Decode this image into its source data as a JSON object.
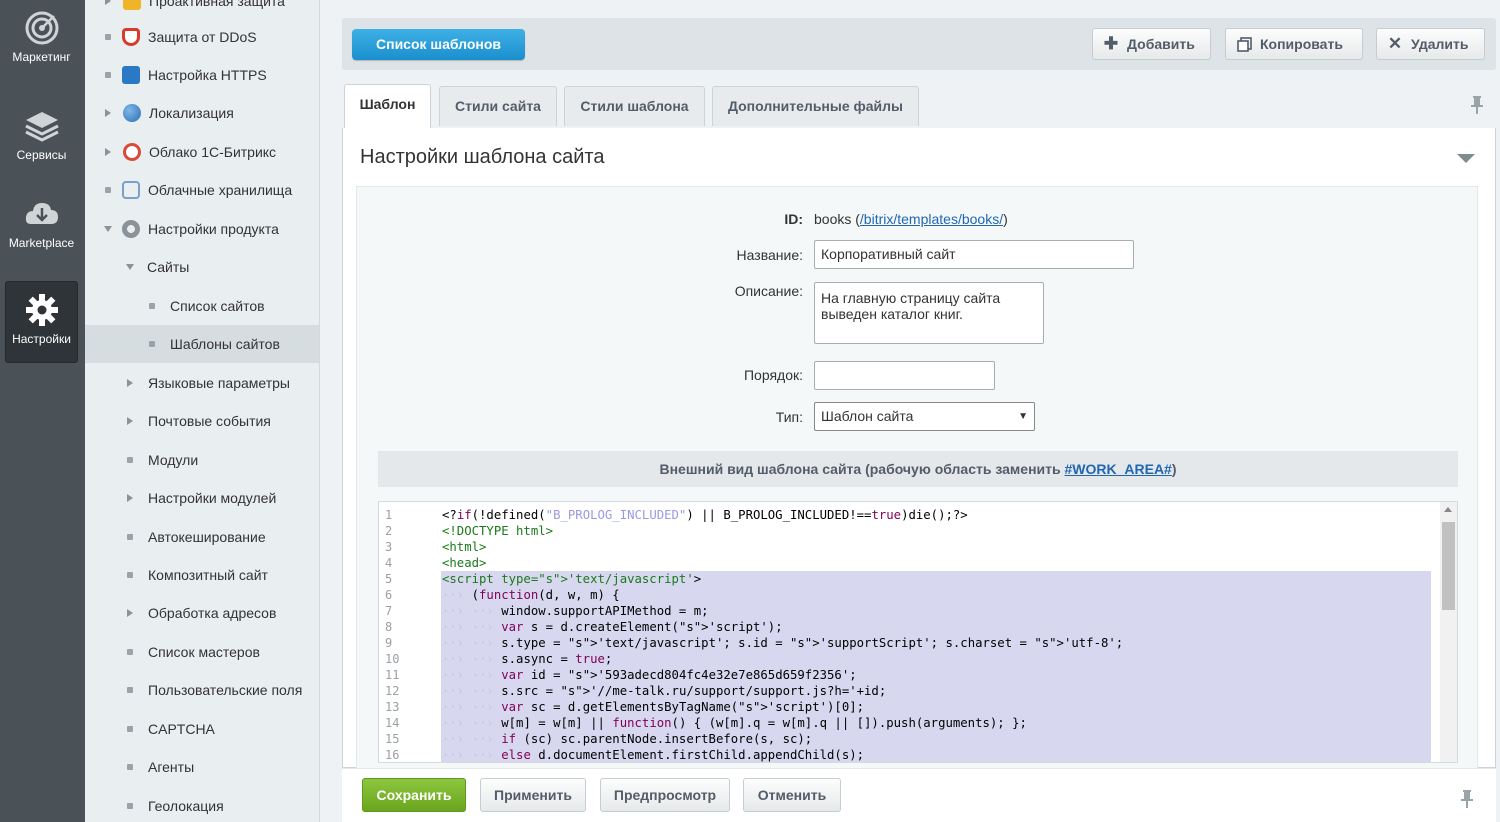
{
  "rail": {
    "items": [
      {
        "label": "Маркетинг",
        "icon": "target-icon"
      },
      {
        "label": "Сервисы",
        "icon": "layers-icon"
      },
      {
        "label": "Marketplace",
        "icon": "cloud-download-icon"
      },
      {
        "label": "Настройки",
        "icon": "gear-icon",
        "active": true
      }
    ]
  },
  "tree": {
    "items": [
      {
        "label": "Проактивная защита"
      },
      {
        "label": "Защита от DDoS"
      },
      {
        "label": "Настройка HTTPS"
      },
      {
        "label": "Локализация"
      },
      {
        "label": "Облако 1С-Битрикс"
      },
      {
        "label": "Облачные хранилища"
      },
      {
        "label": "Настройки продукта"
      },
      {
        "label": "Сайты"
      },
      {
        "label": "Список сайтов"
      },
      {
        "label": "Шаблоны сайтов"
      },
      {
        "label": "Языковые параметры"
      },
      {
        "label": "Почтовые события"
      },
      {
        "label": "Модули"
      },
      {
        "label": "Настройки модулей"
      },
      {
        "label": "Автокеширование"
      },
      {
        "label": "Композитный сайт"
      },
      {
        "label": "Обработка адресов"
      },
      {
        "label": "Список мастеров"
      },
      {
        "label": "Пользовательские поля"
      },
      {
        "label": "CAPTCHA"
      },
      {
        "label": "Агенты"
      },
      {
        "label": "Геолокация"
      }
    ]
  },
  "toolbar": {
    "list_label": "Список шаблонов",
    "add_label": "Добавить",
    "copy_label": "Копировать",
    "delete_label": "Удалить"
  },
  "tabs": [
    {
      "label": "Шаблон",
      "active": true
    },
    {
      "label": "Стили сайта"
    },
    {
      "label": "Стили шаблона"
    },
    {
      "label": "Дополнительные файлы"
    }
  ],
  "section_title": "Настройки шаблона сайта",
  "form": {
    "id_label": "ID:",
    "id_value": "books",
    "id_paren_open": "(",
    "id_link": "/bitrix/templates/books/",
    "id_paren_close": ")",
    "name_label": "Название:",
    "name_value": "Корпоративный сайт",
    "desc_label": "Описание:",
    "desc_value": "На главную страницу сайта выведен каталог книг.",
    "order_label": "Порядок:",
    "order_value": "",
    "type_label": "Тип:",
    "type_value": "Шаблон сайта"
  },
  "appearance": {
    "text": "Внешний вид шаблона сайта (рабочую область заменить ",
    "link": "#WORK_AREA#",
    "close": ")"
  },
  "code_lines": [
    "<?if(!defined(\"B_PROLOG_INCLUDED\") || B_PROLOG_INCLUDED!==true)die();?>",
    "<!DOCTYPE html>",
    "<html>",
    "<head>",
    "<script type='text/javascript'>",
    "    (function(d, w, m) {",
    "        window.supportAPIMethod = m;",
    "        var s = d.createElement('script');",
    "        s.type = 'text/javascript'; s.id = 'supportScript'; s.charset = 'utf-8';",
    "        s.async = true;",
    "        var id = '593adecd804fc4e32e7e865d659f2356';",
    "        s.src = '//me-talk.ru/support/support.js?h='+id;",
    "        var sc = d.getElementsByTagName('script')[0];",
    "        w[m] = w[m] || function() { (w[m].q = w[m].q || []).push(arguments); };",
    "        if (sc) sc.parentNode.insertBefore(s, sc);",
    "        else d.documentElement.firstChild.appendChild(s);"
  ],
  "bottom": {
    "save": "Сохранить",
    "apply": "Применить",
    "preview": "Предпросмотр",
    "cancel": "Отменить"
  },
  "colors": {
    "accent": "#1a8fcd",
    "save_green": "#7ab72f",
    "rail_bg": "#4a5257",
    "link": "#2067b0"
  }
}
